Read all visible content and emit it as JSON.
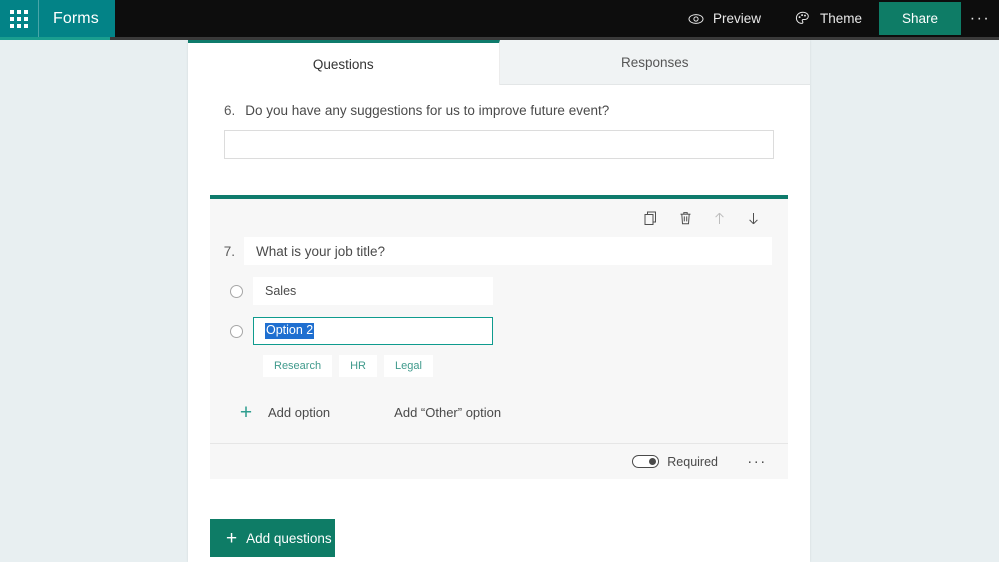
{
  "topbar": {
    "waffle_icon": "app-launcher-waffle-icon",
    "brand": "Forms",
    "preview_label": "Preview",
    "preview_icon": "eye-icon",
    "theme_label": "Theme",
    "theme_icon": "palette-icon",
    "share_label": "Share",
    "more_label": "···"
  },
  "tabs": [
    {
      "label": "Questions",
      "active": true
    },
    {
      "label": "Responses",
      "active": false
    }
  ],
  "question6": {
    "number": "6.",
    "title": "Do you have any suggestions for us to improve future event?",
    "answer_value": "",
    "answer_placeholder": ""
  },
  "question7": {
    "number": "7.",
    "title": "What is your job title?",
    "toolbar": {
      "copy_label": "copy-icon",
      "delete_label": "delete-icon",
      "move_up_label": "move-up-icon",
      "move_down_label": "move-down-icon"
    },
    "options": [
      {
        "value": "Sales",
        "focused": false,
        "selected_text": false
      },
      {
        "value": "Option 2",
        "focused": true,
        "selected_text": true
      }
    ],
    "suggestions": [
      "Research",
      "HR",
      "Legal"
    ],
    "add_option_label": "Add option",
    "add_other_option_label": "Add “Other” option",
    "required_label": "Required",
    "required_on": false,
    "more_label": "···"
  },
  "add_questions_label": "Add questions",
  "colors": {
    "teal_brand": "#038387",
    "teal_accent": "#0f7b6c",
    "teal_share": "#0e7c66",
    "selection_blue": "#1f6fd0",
    "page_bg": "#e8eff1",
    "card_bg": "#f7f7f7"
  }
}
